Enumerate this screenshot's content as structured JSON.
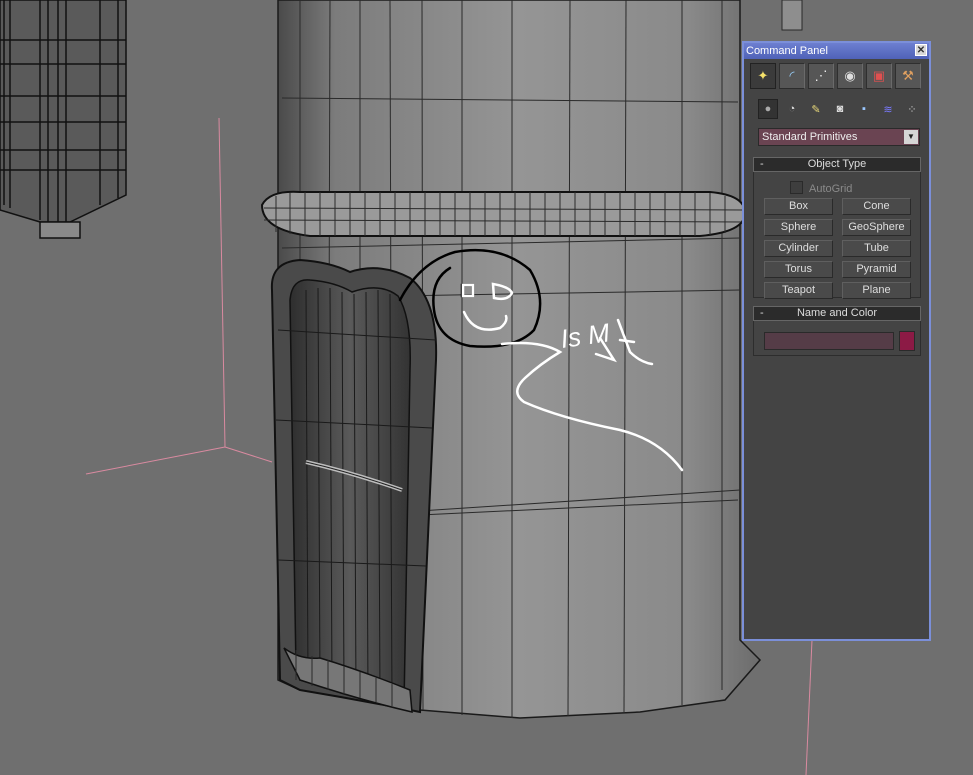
{
  "command_panel": {
    "title": "Command Panel",
    "close_glyph": "✕",
    "tabs": [
      {
        "name": "create-tab",
        "glyph": "✦",
        "active": true
      },
      {
        "name": "modify-tab",
        "glyph": "◜",
        "active": false
      },
      {
        "name": "hierarchy-tab",
        "glyph": "⋰",
        "active": false
      },
      {
        "name": "motion-tab",
        "glyph": "◉",
        "active": false
      },
      {
        "name": "display-tab",
        "glyph": "▣",
        "active": false
      },
      {
        "name": "utilities-tab",
        "glyph": "⚒",
        "active": false
      }
    ],
    "categories": [
      {
        "name": "geometry-icon",
        "glyph": "●",
        "active": true
      },
      {
        "name": "shapes-icon",
        "glyph": "◔",
        "active": false
      },
      {
        "name": "lights-icon",
        "glyph": "✎",
        "active": false
      },
      {
        "name": "cameras-icon",
        "glyph": "◙",
        "active": false
      },
      {
        "name": "helpers-icon",
        "glyph": "▪",
        "active": false
      },
      {
        "name": "space-warps-icon",
        "glyph": "≋",
        "active": false
      },
      {
        "name": "systems-icon",
        "glyph": "⁘",
        "active": false
      }
    ],
    "dropdown": {
      "value": "Standard Primitives",
      "arrow": "▼"
    },
    "object_type": {
      "header": "Object Type",
      "collapse": "-",
      "autogrid_label": "AutoGrid",
      "buttons": [
        "Box",
        "Cone",
        "Sphere",
        "GeoSphere",
        "Cylinder",
        "Tube",
        "Torus",
        "Pyramid",
        "Teapot",
        "Plane"
      ]
    },
    "name_color": {
      "header": "Name and Color",
      "collapse": "-",
      "name_value": "",
      "swatch_color": "#8c1a45"
    }
  },
  "viewport": {
    "annotation_text": "Is M"
  }
}
